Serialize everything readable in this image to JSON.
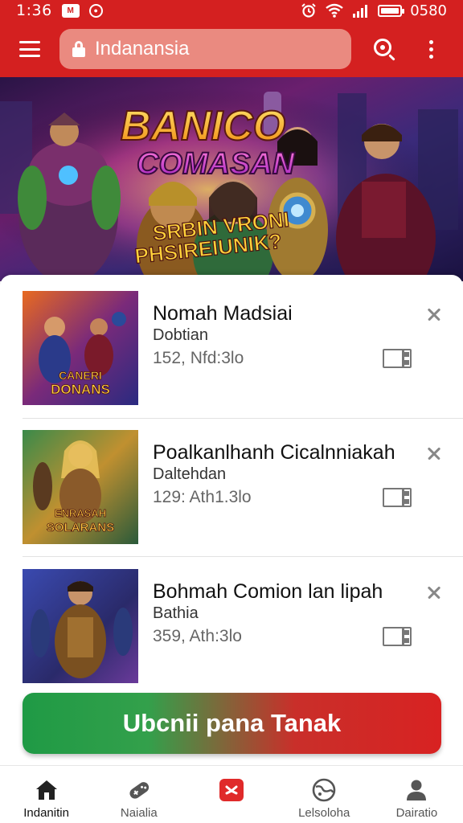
{
  "status_bar": {
    "time": "1:36",
    "battery_level": 100,
    "battery_text": "0580"
  },
  "address_bar": {
    "text": "Indanansia"
  },
  "hero": {
    "title_line1": "BANICO",
    "title_line2": "COMASAN",
    "tagline_line1": "SRBIN VRONI",
    "tagline_line2": "PHSIREIUNIK?"
  },
  "list": {
    "items": [
      {
        "title": "Nomah Madsiai",
        "subtitle": "Dobtian",
        "meta": "152, Nfd:3lo",
        "thumb_caption_1": "CANERI",
        "thumb_caption_2": "DONANS"
      },
      {
        "title": "Poalkanlhanh Cicalnniakah",
        "subtitle": "Daltehdan",
        "meta": "129: Ath1.3lo",
        "thumb_caption_1": "ENRASAH",
        "thumb_caption_2": "SOLARANS"
      },
      {
        "title": "Bohmah Comion lan lipah",
        "subtitle": "Bathia",
        "meta": "359, Ath:3lo",
        "thumb_caption_1": "",
        "thumb_caption_2": ""
      }
    ]
  },
  "cta": {
    "label": "Ubcnii pana Tanak"
  },
  "bottom_nav": {
    "items": [
      {
        "label": "Indanitin",
        "icon": "home-icon",
        "active": true
      },
      {
        "label": "Naialia",
        "icon": "gamepad-icon",
        "active": false
      },
      {
        "label": "",
        "icon": "video-play-icon",
        "active": false
      },
      {
        "label": "Lelsoloha",
        "icon": "globe-icon",
        "active": false
      },
      {
        "label": "Dairatio",
        "icon": "profile-icon",
        "active": false
      }
    ]
  },
  "colors": {
    "primary_red": "#d42020",
    "search_bg": "#ea8a80",
    "cta_green": "#1f9a45",
    "cta_red": "#d82222"
  }
}
